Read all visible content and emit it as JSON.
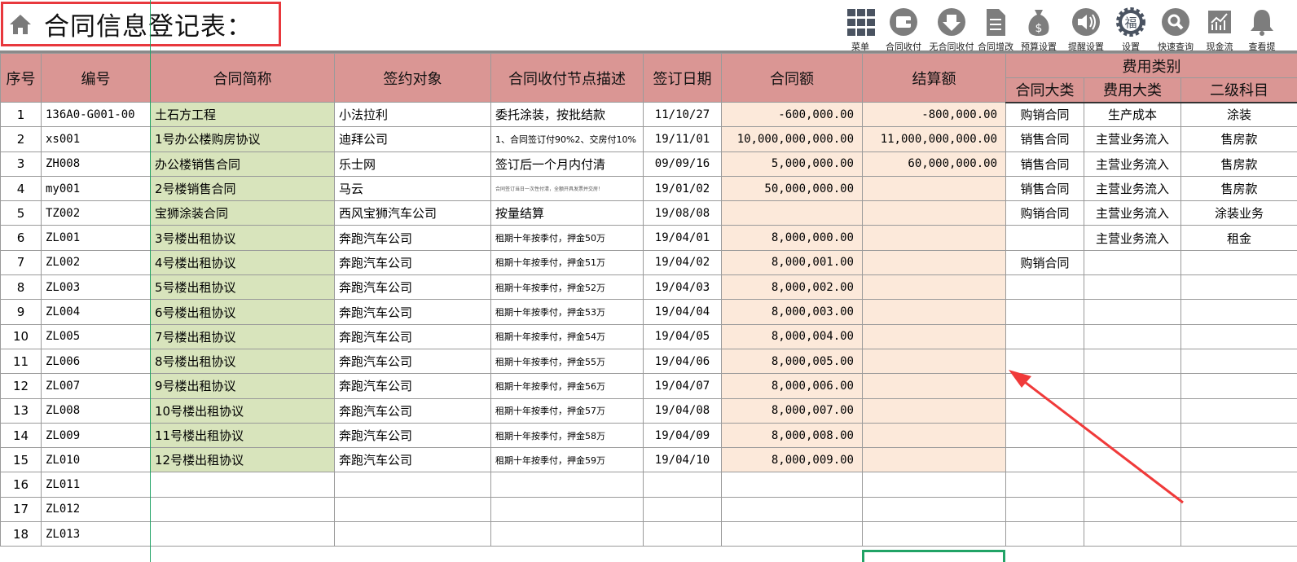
{
  "title": "合同信息登记表：",
  "toolbar": [
    {
      "icon": "grid-menu-icon",
      "label": "菜单"
    },
    {
      "icon": "wallet-icon",
      "label": "合同收付"
    },
    {
      "icon": "yuan-down-icon",
      "label": "无合同收付"
    },
    {
      "icon": "document-icon",
      "label": "合同增改"
    },
    {
      "icon": "money-bag-icon",
      "label": "预算设置"
    },
    {
      "icon": "speaker-icon",
      "label": "提醒设置"
    },
    {
      "icon": "gear-fu-icon",
      "label": "设置"
    },
    {
      "icon": "search-icon",
      "label": "快速查询"
    },
    {
      "icon": "chart-icon",
      "label": "现金流"
    },
    {
      "icon": "bell-icon",
      "label": "查看提"
    }
  ],
  "headers": {
    "seq": "序号",
    "code": "编号",
    "name": "合同简称",
    "party": "签约对象",
    "desc": "合同收付节点描述",
    "date": "签订日期",
    "amount": "合同额",
    "settle": "结算额",
    "fee_group": "费用类别",
    "cat1": "合同大类",
    "cat2": "费用大类",
    "cat3": "二级科目"
  },
  "rows": [
    [
      "1",
      "136A0-G001-00",
      "土石方工程",
      "小法拉利",
      "委托涂装，按批结款",
      "11/10/27",
      "-600,000.00",
      "-800,000.00",
      "购销合同",
      "生产成本",
      "涂装"
    ],
    [
      "2",
      "xs001",
      "1号办公楼购房协议",
      "迪拜公司",
      "1、合同签订付90%2、交房付10%",
      "19/11/01",
      "10,000,000,000.00",
      "11,000,000,000.00",
      "销售合同",
      "主营业务流入",
      "售房款"
    ],
    [
      "3",
      "ZH008",
      "办公楼销售合同",
      "乐士网",
      "签订后一个月内付清",
      "09/09/16",
      "5,000,000.00",
      "60,000,000.00",
      "销售合同",
      "主营业务流入",
      "售房款"
    ],
    [
      "4",
      "my001",
      "2号楼销售合同",
      "马云",
      "合同签订当日一次性付清，全额开具发票并交房！",
      "19/01/02",
      "50,000,000.00",
      "",
      "销售合同",
      "主营业务流入",
      "售房款"
    ],
    [
      "5",
      "TZ002",
      "宝狮涂装合同",
      "西风宝狮汽车公司",
      "按量结算",
      "19/08/08",
      "",
      "",
      "购销合同",
      "主营业务流入",
      "涂装业务"
    ],
    [
      "6",
      "ZL001",
      "3号楼出租协议",
      "奔跑汽车公司",
      "租期十年按季付，押金50万",
      "19/04/01",
      "8,000,000.00",
      "",
      "",
      "主营业务流入",
      "租金"
    ],
    [
      "7",
      "ZL002",
      "4号楼出租协议",
      "奔跑汽车公司",
      "租期十年按季付，押金51万",
      "19/04/02",
      "8,000,001.00",
      "",
      "购销合同",
      "",
      ""
    ],
    [
      "8",
      "ZL003",
      "5号楼出租协议",
      "奔跑汽车公司",
      "租期十年按季付，押金52万",
      "19/04/03",
      "8,000,002.00",
      "",
      "",
      "",
      ""
    ],
    [
      "9",
      "ZL004",
      "6号楼出租协议",
      "奔跑汽车公司",
      "租期十年按季付，押金53万",
      "19/04/04",
      "8,000,003.00",
      "",
      "",
      "",
      ""
    ],
    [
      "10",
      "ZL005",
      "7号楼出租协议",
      "奔跑汽车公司",
      "租期十年按季付，押金54万",
      "19/04/05",
      "8,000,004.00",
      "",
      "",
      "",
      ""
    ],
    [
      "11",
      "ZL006",
      "8号楼出租协议",
      "奔跑汽车公司",
      "租期十年按季付，押金55万",
      "19/04/06",
      "8,000,005.00",
      "",
      "",
      "",
      ""
    ],
    [
      "12",
      "ZL007",
      "9号楼出租协议",
      "奔跑汽车公司",
      "租期十年按季付，押金56万",
      "19/04/07",
      "8,000,006.00",
      "",
      "",
      "",
      ""
    ],
    [
      "13",
      "ZL008",
      "10号楼出租协议",
      "奔跑汽车公司",
      "租期十年按季付，押金57万",
      "19/04/08",
      "8,000,007.00",
      "",
      "",
      "",
      ""
    ],
    [
      "14",
      "ZL009",
      "11号楼出租协议",
      "奔跑汽车公司",
      "租期十年按季付，押金58万",
      "19/04/09",
      "8,000,008.00",
      "",
      "",
      "",
      ""
    ],
    [
      "15",
      "ZL010",
      "12号楼出租协议",
      "奔跑汽车公司",
      "租期十年按季付，押金59万",
      "19/04/10",
      "8,000,009.00",
      "",
      "",
      "",
      ""
    ],
    [
      "16",
      "ZL011",
      "",
      "",
      "",
      "",
      "",
      "",
      "",
      "",
      ""
    ],
    [
      "17",
      "ZL012",
      "",
      "",
      "",
      "",
      "",
      "",
      "",
      "",
      ""
    ],
    [
      "18",
      "ZL013",
      "",
      "",
      "",
      "",
      "",
      "",
      "",
      "",
      ""
    ]
  ],
  "colors": {
    "header": "#da9694",
    "green": "#d8e4bc",
    "peach": "#fce9da",
    "accent": "#e8383d"
  }
}
